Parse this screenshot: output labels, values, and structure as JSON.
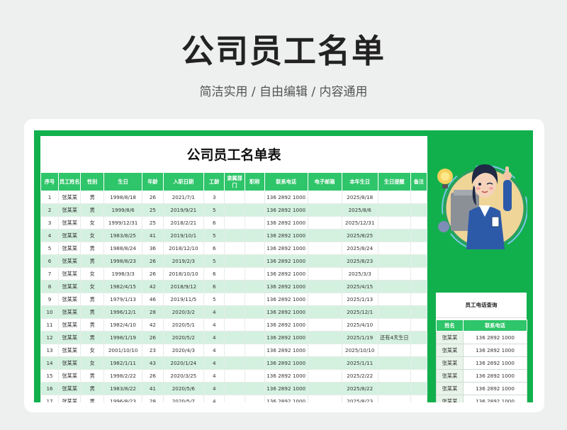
{
  "page": {
    "title": "公司员工名单",
    "subtitle": "简洁实用 / 自由编辑 / 内容通用"
  },
  "sheet": {
    "title": "公司员工名单表",
    "headers": [
      "序号",
      "员工姓名",
      "性别",
      "生日",
      "年龄",
      "入职日期",
      "工龄",
      "隶属部门",
      "职称",
      "联系电话",
      "电子邮箱",
      "本年生日",
      "生日提醒",
      "备注"
    ],
    "rows": [
      [
        "1",
        "张某某",
        "男",
        "1998/8/18",
        "26",
        "2021/7/1",
        "3",
        "",
        "",
        "136 2892 1000",
        "",
        "2025/8/18",
        "",
        ""
      ],
      [
        "2",
        "张某某",
        "男",
        "1999/8/6",
        "25",
        "2019/9/21",
        "5",
        "",
        "",
        "136 2892 1000",
        "",
        "2025/8/6",
        "",
        ""
      ],
      [
        "3",
        "张某某",
        "女",
        "1999/12/31",
        "25",
        "2018/2/21",
        "6",
        "",
        "",
        "136 2892 1000",
        "",
        "2025/12/31",
        "",
        ""
      ],
      [
        "4",
        "张某某",
        "女",
        "1983/8/25",
        "41",
        "2019/10/1",
        "5",
        "",
        "",
        "136 2892 1000",
        "",
        "2025/8/25",
        "",
        ""
      ],
      [
        "5",
        "张某某",
        "男",
        "1988/8/24",
        "36",
        "2018/12/10",
        "6",
        "",
        "",
        "136 2892 1000",
        "",
        "2025/8/24",
        "",
        ""
      ],
      [
        "6",
        "张某某",
        "男",
        "1998/8/23",
        "26",
        "2019/2/3",
        "5",
        "",
        "",
        "136 2892 1000",
        "",
        "2025/8/23",
        "",
        ""
      ],
      [
        "7",
        "张某某",
        "女",
        "1998/3/3",
        "26",
        "2018/10/10",
        "6",
        "",
        "",
        "136 2892 1000",
        "",
        "2025/3/3",
        "",
        ""
      ],
      [
        "8",
        "张某某",
        "女",
        "1982/4/15",
        "42",
        "2018/9/12",
        "6",
        "",
        "",
        "136 2892 1000",
        "",
        "2025/4/15",
        "",
        ""
      ],
      [
        "9",
        "张某某",
        "男",
        "1979/1/13",
        "46",
        "2019/11/5",
        "5",
        "",
        "",
        "136 2892 1000",
        "",
        "2025/1/13",
        "",
        ""
      ],
      [
        "10",
        "张某某",
        "男",
        "1996/12/1",
        "28",
        "2020/3/2",
        "4",
        "",
        "",
        "136 2892 1000",
        "",
        "2025/12/1",
        "",
        ""
      ],
      [
        "11",
        "张某某",
        "男",
        "1982/4/10",
        "42",
        "2020/5/1",
        "4",
        "",
        "",
        "136 2892 1000",
        "",
        "2025/4/10",
        "",
        ""
      ],
      [
        "12",
        "张某某",
        "男",
        "1998/1/19",
        "26",
        "2020/5/2",
        "4",
        "",
        "",
        "136 2892 1000",
        "",
        "2025/1/19",
        "还有4天生日",
        ""
      ],
      [
        "13",
        "张某某",
        "女",
        "2001/10/10",
        "23",
        "2020/4/3",
        "4",
        "",
        "",
        "136 2892 1000",
        "",
        "2025/10/10",
        "",
        ""
      ],
      [
        "14",
        "张某某",
        "女",
        "1982/1/11",
        "43",
        "2020/1/24",
        "4",
        "",
        "",
        "136 2892 1000",
        "",
        "2025/1/11",
        "",
        ""
      ],
      [
        "15",
        "张某某",
        "男",
        "1998/2/22",
        "26",
        "2020/3/25",
        "4",
        "",
        "",
        "136 2892 1000",
        "",
        "2025/2/22",
        "",
        ""
      ],
      [
        "16",
        "张某某",
        "男",
        "1983/8/22",
        "41",
        "2020/5/6",
        "4",
        "",
        "",
        "136 2892 1000",
        "",
        "2025/8/22",
        "",
        ""
      ],
      [
        "17",
        "张某某",
        "男",
        "1996/8/23",
        "28",
        "2020/5/7",
        "4",
        "",
        "",
        "136 2892 1000",
        "",
        "2025/8/23",
        "",
        ""
      ]
    ]
  },
  "lookup": {
    "title": "员工电话查询",
    "headers": [
      "姓名",
      "联系电话"
    ],
    "rows": [
      [
        "张某某",
        "136 2892 1000"
      ],
      [
        "张某某",
        "136 2892 1000"
      ],
      [
        "张某某",
        "136 2892 1000"
      ],
      [
        "张某某",
        "136 2892 1000"
      ],
      [
        "张某某",
        "136 2892 1000"
      ],
      [
        "张某某",
        "136 2892 1000"
      ],
      [
        "张某某",
        "136 2892 1000"
      ]
    ]
  },
  "colors": {
    "frame_green": "#11b04d",
    "header_green": "#2fc56a",
    "stripe": "#d4f1e0"
  },
  "icons": {
    "illustration": "staff-woman-thumbs-up-illustration"
  }
}
